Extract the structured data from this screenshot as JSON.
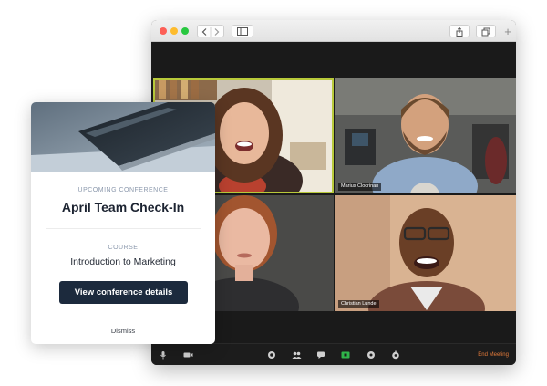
{
  "browser": {
    "toolbar": {
      "back_icon": "chevron-left-icon",
      "forward_icon": "chevron-right-icon",
      "sidebar_icon": "sidebar-icon",
      "share_icon": "share-icon",
      "tabs_icon": "tabs-icon",
      "new_tab_label": "+"
    }
  },
  "meeting": {
    "participants": [
      {
        "name": "",
        "active_speaker": true
      },
      {
        "name": "Marius Clocrinan"
      },
      {
        "name": ""
      },
      {
        "name": "Christian Lunde"
      }
    ],
    "controls": {
      "icons": [
        "microphone-icon",
        "camera-icon",
        "share-screen-icon",
        "participants-icon",
        "chat-icon",
        "record-icon",
        "reactions-icon",
        "settings-icon"
      ],
      "end_label": "End Meeting"
    },
    "colors": {
      "active_outline": "#b8c93a",
      "end_meeting": "#e57b3a"
    }
  },
  "card": {
    "eyebrow": "UPCOMING CONFERENCE",
    "title": "April Team Check-In",
    "course_label": "COURSE",
    "course_name": "Introduction to Marketing",
    "cta_label": "View conference details",
    "dismiss_label": "Dismiss",
    "colors": {
      "cta_bg": "#1c2a3d",
      "eyebrow": "#8c99ad"
    }
  }
}
